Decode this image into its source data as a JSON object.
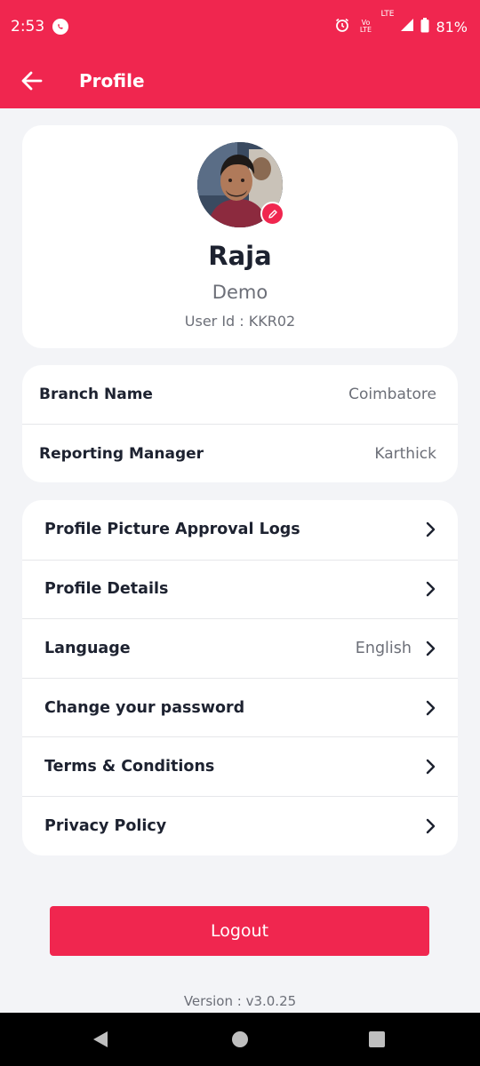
{
  "status_bar": {
    "time": "2:53",
    "volte_label": "Vo LTE",
    "network_label": "LTE",
    "battery": "81%",
    "icons": [
      "whatsapp-icon",
      "alarm-icon",
      "signal-icon",
      "battery-icon"
    ]
  },
  "app_bar": {
    "title": "Profile",
    "back_icon": "arrow-left-icon"
  },
  "profile": {
    "name": "Raja",
    "role": "Demo",
    "user_id_label": "User Id : ",
    "user_id": "KKR02"
  },
  "info": [
    {
      "label": "Branch Name",
      "value": "Coimbatore"
    },
    {
      "label": "Reporting Manager",
      "value": "Karthick"
    }
  ],
  "menu": [
    {
      "label": "Profile Picture Approval Logs",
      "value": ""
    },
    {
      "label": "Profile Details",
      "value": ""
    },
    {
      "label": "Language",
      "value": "English"
    },
    {
      "label": "Change your password",
      "value": ""
    },
    {
      "label": "Terms & Conditions",
      "value": ""
    },
    {
      "label": "Privacy Policy",
      "value": ""
    }
  ],
  "logout_label": "Logout",
  "version": "Version : v3.0.25",
  "colors": {
    "brand": "#f0264f",
    "background": "#f3f4f7",
    "card": "#ffffff",
    "secondary_text": "#6c6f78"
  }
}
